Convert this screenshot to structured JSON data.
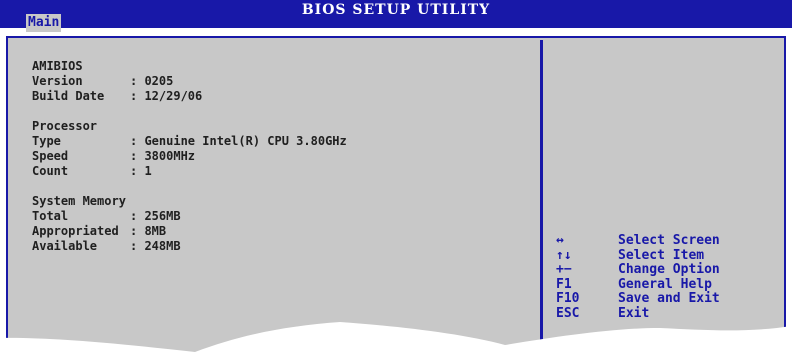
{
  "title": "BIOS SETUP UTILITY",
  "tab": "Main",
  "sections": [
    {
      "heading": "AMIBIOS",
      "rows": [
        {
          "label": "Version",
          "value": ": 0205"
        },
        {
          "label": "Build Date",
          "value": ": 12/29/06"
        }
      ]
    },
    {
      "heading": "Processor",
      "rows": [
        {
          "label": "Type",
          "value": ": Genuine Intel(R) CPU 3.80GHz"
        },
        {
          "label": "Speed",
          "value": ": 3800MHz"
        },
        {
          "label": "Count",
          "value": ": 1"
        }
      ]
    },
    {
      "heading": "System Memory",
      "rows": [
        {
          "label": "Total",
          "value": ": 256MB"
        },
        {
          "label": "Appropriated",
          "value": ": 8MB"
        },
        {
          "label": "Available",
          "value": ": 248MB"
        }
      ]
    }
  ],
  "help": [
    {
      "key": "↔",
      "desc": "Select Screen",
      "icon": "left-right-arrows-icon"
    },
    {
      "key": "↑↓",
      "desc": "Select Item",
      "icon": "up-down-arrows-icon"
    },
    {
      "key": "+−",
      "desc": "Change Option",
      "icon": "plus-minus-icon"
    },
    {
      "key": "F1",
      "desc": "General Help"
    },
    {
      "key": "F10",
      "desc": "Save and Exit"
    },
    {
      "key": "ESC",
      "desc": "Exit"
    }
  ],
  "colors": {
    "blue": "#1818a8",
    "panel": "#c8c8c8",
    "text": "#202020",
    "white": "#ffffff"
  }
}
